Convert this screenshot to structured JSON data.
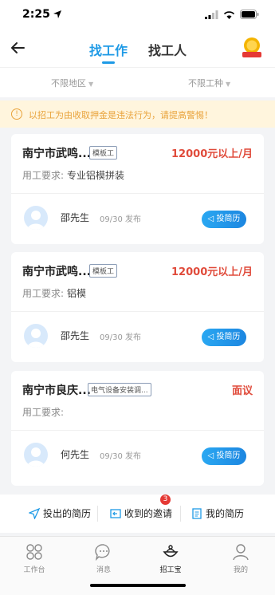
{
  "status_bar": {
    "time": "2:25"
  },
  "header": {
    "tab_active": "找工作",
    "tab_inactive": "找工人",
    "badge_icon": "medal-icon"
  },
  "filters": {
    "region": "不限地区",
    "job_type": "不限工种"
  },
  "warning": {
    "text": "以招工为由收取押金是违法行为，请提高警惕！"
  },
  "cards": [
    {
      "title": "南宁市武鸣...",
      "tag": "模板工",
      "salary": "12000元以上/月",
      "req_label": "用工要求:",
      "req_value": "专业铝模拼装",
      "poster": "邵先生",
      "date": "09/30 发布",
      "apply": "投简历"
    },
    {
      "title": "南宁市武鸣...",
      "tag": "模板工",
      "salary": "12000元以上/月",
      "req_label": "用工要求:",
      "req_value": "铝模",
      "poster": "邵先生",
      "date": "09/30 发布",
      "apply": "投简历"
    },
    {
      "title": "南宁市良庆...",
      "tag": "电气设备安装调...",
      "salary": "面议",
      "req_label": "用工要求:",
      "req_value": "",
      "poster": "何先生",
      "date": "09/30 发布",
      "apply": "投简历"
    }
  ],
  "actions": {
    "sent": "投出的简历",
    "received": "收到的邀请",
    "received_badge": "3",
    "mine": "我的简历"
  },
  "bottom_nav": [
    {
      "label": "工作台",
      "icon": "workbench-icon"
    },
    {
      "label": "消息",
      "icon": "message-icon"
    },
    {
      "label": "招工宝",
      "icon": "recruit-treasure-icon"
    },
    {
      "label": "我的",
      "icon": "profile-icon"
    }
  ],
  "colors": {
    "accent": "#1e9ae6",
    "salary": "#e04b3b",
    "warning": "#e9a33b"
  }
}
